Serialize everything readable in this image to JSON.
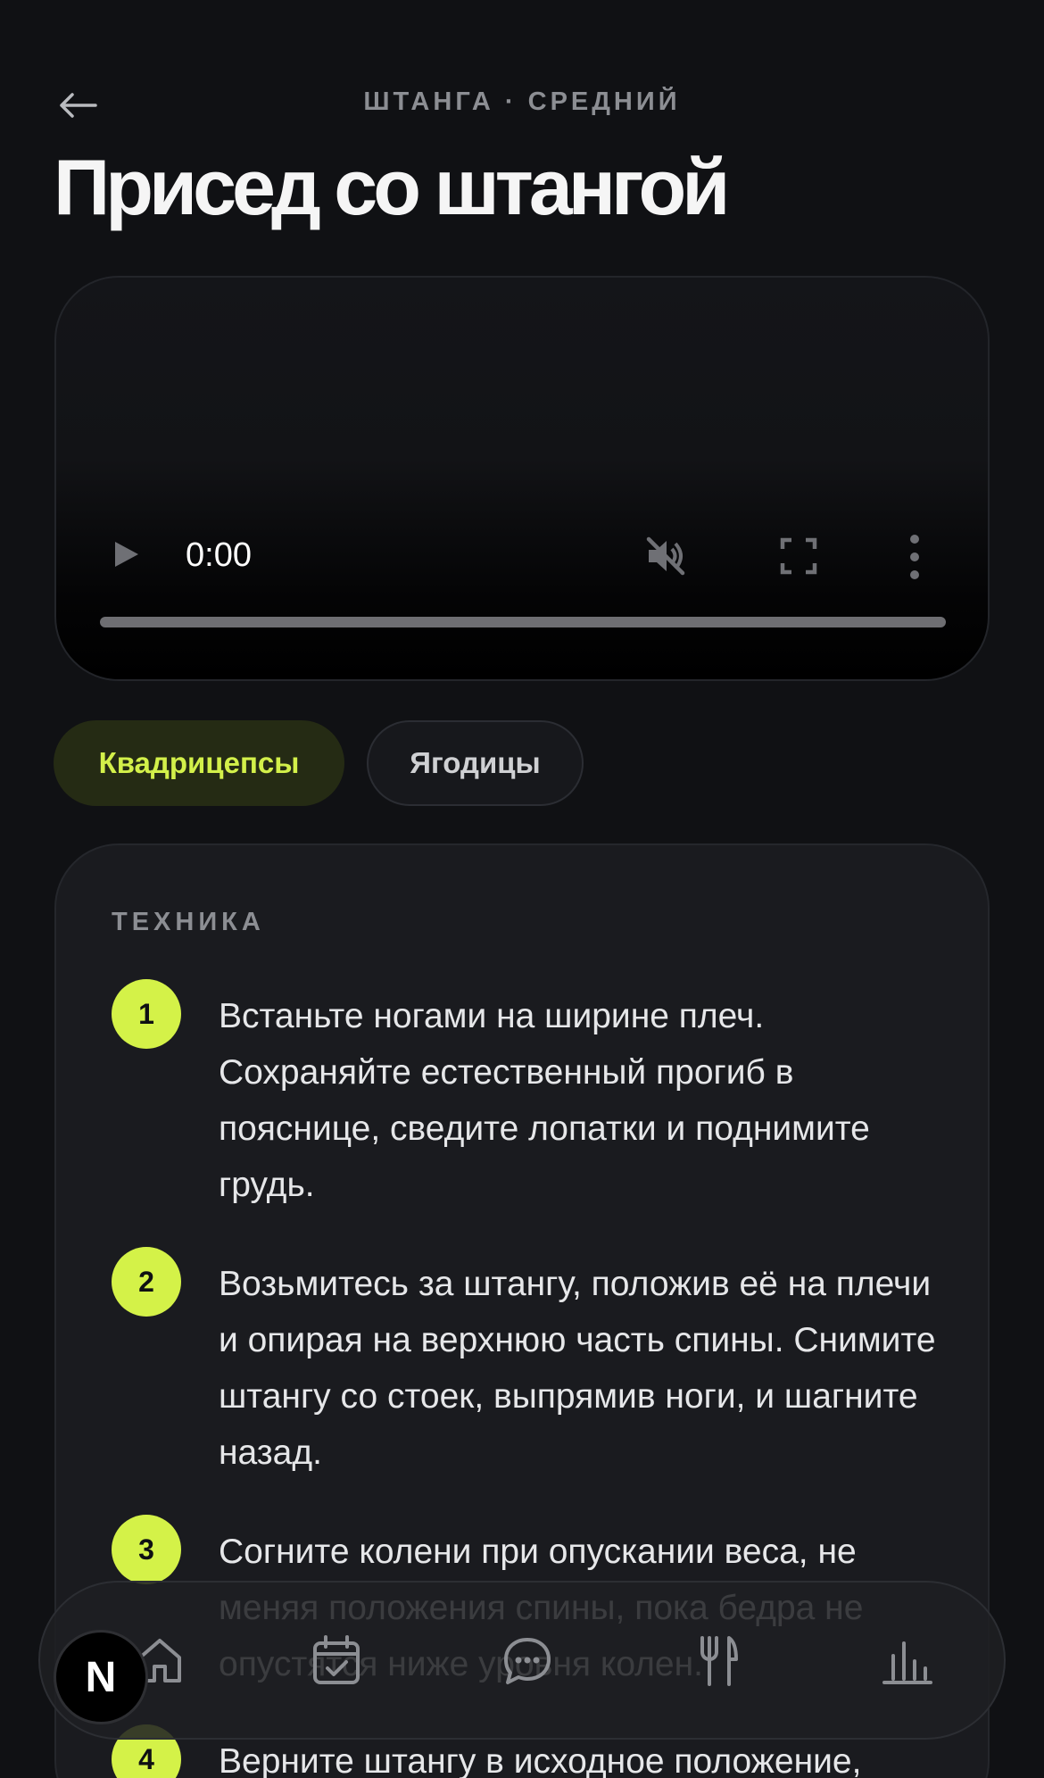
{
  "header": {
    "kicker": "ШТАНГА · СРЕДНИЙ",
    "title": "Присед со штангой"
  },
  "video": {
    "time": "0:00",
    "progress": 0
  },
  "muscles": [
    {
      "label": "Квадрицепсы",
      "active": true
    },
    {
      "label": "Ягодицы",
      "active": false
    }
  ],
  "technique": {
    "title": "ТЕХНИКА",
    "steps": [
      {
        "num": "1",
        "text": "Встаньте ногами на ширине плеч. Сохраняйте естественный прогиб в пояснице, сведите лопатки и поднимите грудь."
      },
      {
        "num": "2",
        "text": "Возьмитесь за штангу, положив её на плечи и опирая на верхнюю часть спины. Снимите штангу со стоек, выпрямив ноги, и шагните назад."
      },
      {
        "num": "3",
        "text": "Согните колени при опускании веса, не меняя положения спины, пока бедра не опустятся ниже уровня колен."
      },
      {
        "num": "4",
        "text": "Верните штангу в исходное положение,"
      }
    ]
  },
  "tabbar": {
    "icons": [
      "home-icon",
      "calendar-check-icon",
      "chat-icon",
      "fork-knife-icon",
      "bar-chart-icon"
    ]
  },
  "logo": {
    "letter": "N"
  },
  "colors": {
    "background": "#101114",
    "accent": "#d4f248",
    "card": "#1a1b1f"
  }
}
